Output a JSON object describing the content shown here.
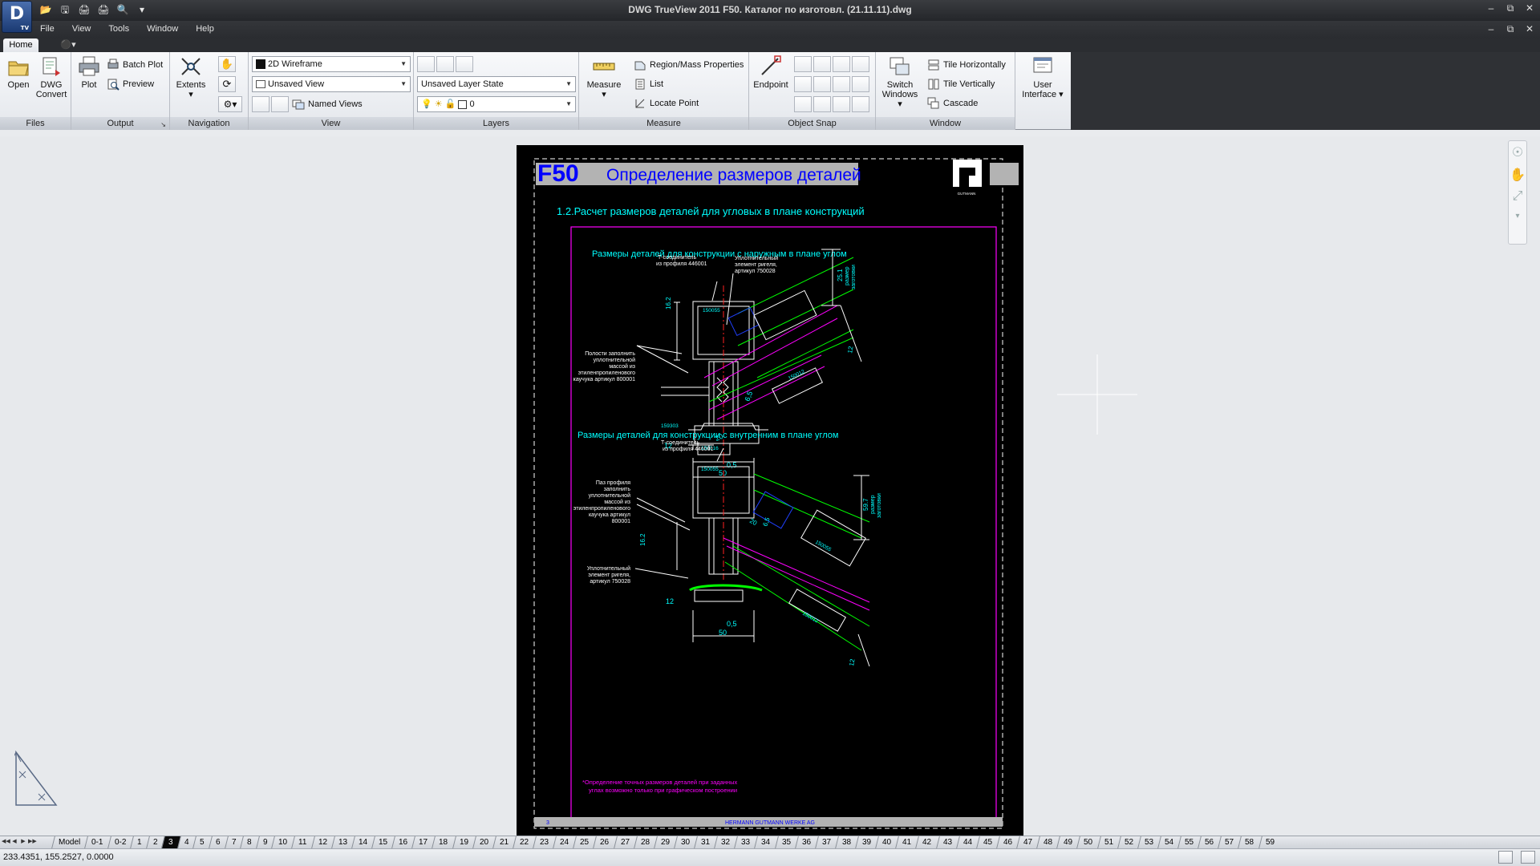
{
  "app": {
    "title": "DWG TrueView 2011    F50. Каталог по изготовл. (21.11.11).dwg",
    "logo": "D",
    "logo_sub": "TV"
  },
  "menu": [
    "File",
    "View",
    "Tools",
    "Window",
    "Help"
  ],
  "ribbon": {
    "tabs": [
      "Home"
    ],
    "panels": {
      "files": {
        "title": "Files",
        "open": "Open",
        "dwg_convert_1": "DWG",
        "dwg_convert_2": "Convert"
      },
      "output": {
        "title": "Output",
        "plot": "Plot",
        "batch_plot": "Batch Plot",
        "preview": "Preview"
      },
      "navigation": {
        "title": "Navigation",
        "extents": "Extents"
      },
      "view": {
        "title": "View",
        "visual_style": "2D Wireframe",
        "saved_view": "Unsaved View",
        "named_views": "Named Views"
      },
      "layers": {
        "title": "Layers",
        "layer_state": "Unsaved Layer State",
        "current_layer": "0"
      },
      "measure": {
        "title": "Measure",
        "measure": "Measure",
        "region_mass": "Region/Mass Properties",
        "list": "List",
        "locate_point": "Locate Point"
      },
      "object_snap": {
        "title": "Object Snap",
        "endpoint": "Endpoint"
      },
      "window": {
        "title": "Window",
        "switch_1": "Switch",
        "switch_2": "Windows",
        "tile_h": "Tile Horizontally",
        "tile_v": "Tile Vertically",
        "cascade": "Cascade"
      },
      "ui": {
        "user_1": "User",
        "user_2": "Interface"
      }
    }
  },
  "drawing": {
    "code": "F50",
    "title": "Определение размеров деталей",
    "brand": "GUTMANN",
    "subtitle": "1.2.Расчет размеров деталей для угловых в плане конструкций",
    "section1": "Размеры деталей для конструкции с наружным в плане углом",
    "section2": "Размеры деталей для конструкции с внутренним в плане углом",
    "s1_label_t1": "Т-соединитель",
    "s1_label_t2": "из профиля 446001",
    "s1_label_seal1": "Уплотнительный",
    "s1_label_seal2": "элемент ригеля,",
    "s1_label_seal3": "артикул 750028",
    "s1_fill1": "Полости заполнить",
    "s1_fill2": "уплотнительной",
    "s1_fill3": "массой из",
    "s1_fill4": "этиленпропиленового",
    "s1_fill5": "каучука артикул 800001",
    "s2_label_t1": "Т-соединитель",
    "s2_label_t2": "из профиля 446001",
    "s2_fill1": "Паз профиля",
    "s2_fill2": "заполнить",
    "s2_fill3": "уплотнительной",
    "s2_fill4": "массой из",
    "s2_fill5": "этиленпропиленового",
    "s2_fill6": "каучука артикул",
    "s2_fill7": "800001",
    "s2_seal1": "Уплотнительный",
    "s2_seal2": "элемент ригеля,",
    "s2_seal3": "артикул 750028",
    "dim_12": "12",
    "dim_50": "50",
    "dim_05": "0,5",
    "dim_20": "20",
    "dim_65": "6,5",
    "dim_162": "16.2",
    "dim_251": "25.1",
    "dim_597": "59.7",
    "dim_razmer1": "размер",
    "dim_razmer2": "заготовки",
    "p150055": "150055",
    "p150012": "150012",
    "p159303": "159303",
    "p150016": "150016",
    "note1": "*Определение точных размеров деталей при заданных",
    "note2": "углах возможно только при графическом построении",
    "footer_page": "3",
    "footer_company": "HERMANN GUTMANN WERKE AG"
  },
  "layout_tabs": [
    "Model",
    "0-1",
    "0-2",
    "1",
    "2",
    "3",
    "4",
    "5",
    "6",
    "7",
    "8",
    "9",
    "10",
    "11",
    "12",
    "13",
    "14",
    "15",
    "16",
    "17",
    "18",
    "19",
    "20",
    "21",
    "22",
    "23",
    "24",
    "25",
    "26",
    "27",
    "28",
    "29",
    "30",
    "31",
    "32",
    "33",
    "34",
    "35",
    "36",
    "37",
    "38",
    "39",
    "40",
    "41",
    "42",
    "43",
    "44",
    "45",
    "46",
    "47",
    "48",
    "49",
    "50",
    "51",
    "52",
    "53",
    "54",
    "55",
    "56",
    "57",
    "58",
    "59"
  ],
  "active_tab": "3",
  "status": {
    "coords": "233.4351, 155.2527, 0.0000"
  }
}
